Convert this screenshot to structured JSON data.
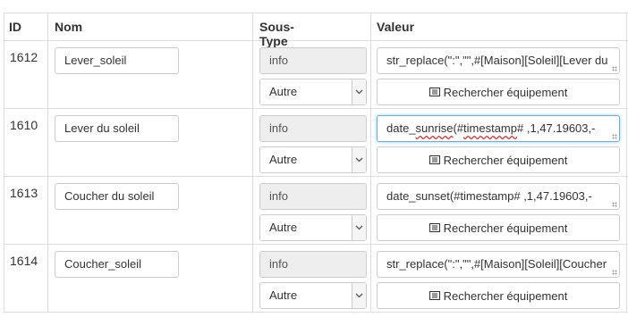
{
  "table": {
    "headers": {
      "id": "ID",
      "nom": "Nom",
      "sous_type": "Sous-Type",
      "valeur": "Valeur"
    },
    "rows": [
      {
        "id": "1612",
        "nom": "Lever_soleil",
        "sous_type": "info",
        "type": "Autre",
        "valeur": "str_replace(\":\",\"\",#[Maison][Soleil][Lever du",
        "button": "Rechercher équipement",
        "focused": false
      },
      {
        "id": "1610",
        "nom": "Lever du soleil",
        "sous_type": "info",
        "type": "Autre",
        "valeur_pre": "date_",
        "valeur_mis": "sunrise",
        "valeur_mid": "(#",
        "valeur_mis2": "timestamp",
        "valeur_post": "# ,1,47.19603,-",
        "button": "Rechercher équipement",
        "focused": true
      },
      {
        "id": "1613",
        "nom": "Coucher du soleil",
        "sous_type": "info",
        "type": "Autre",
        "valeur": "date_sunset(#timestamp# ,1,47.19603,-",
        "button": "Rechercher équipement",
        "focused": false
      },
      {
        "id": "1614",
        "nom": "Coucher_soleil",
        "sous_type": "info",
        "type": "Autre",
        "valeur": "str_replace(\":\",\"\",#[Maison][Soleil][Coucher",
        "button": "Rechercher équipement",
        "focused": false
      }
    ]
  },
  "icons": {
    "select_arrow": "chevron-down-icon",
    "button_icon": "list-icon"
  },
  "colors": {
    "border": "#dddddd",
    "input_border": "#cccccc",
    "readonly_bg": "#eeeeee",
    "focus": "#66afe9",
    "spell_error": "#e03030"
  }
}
